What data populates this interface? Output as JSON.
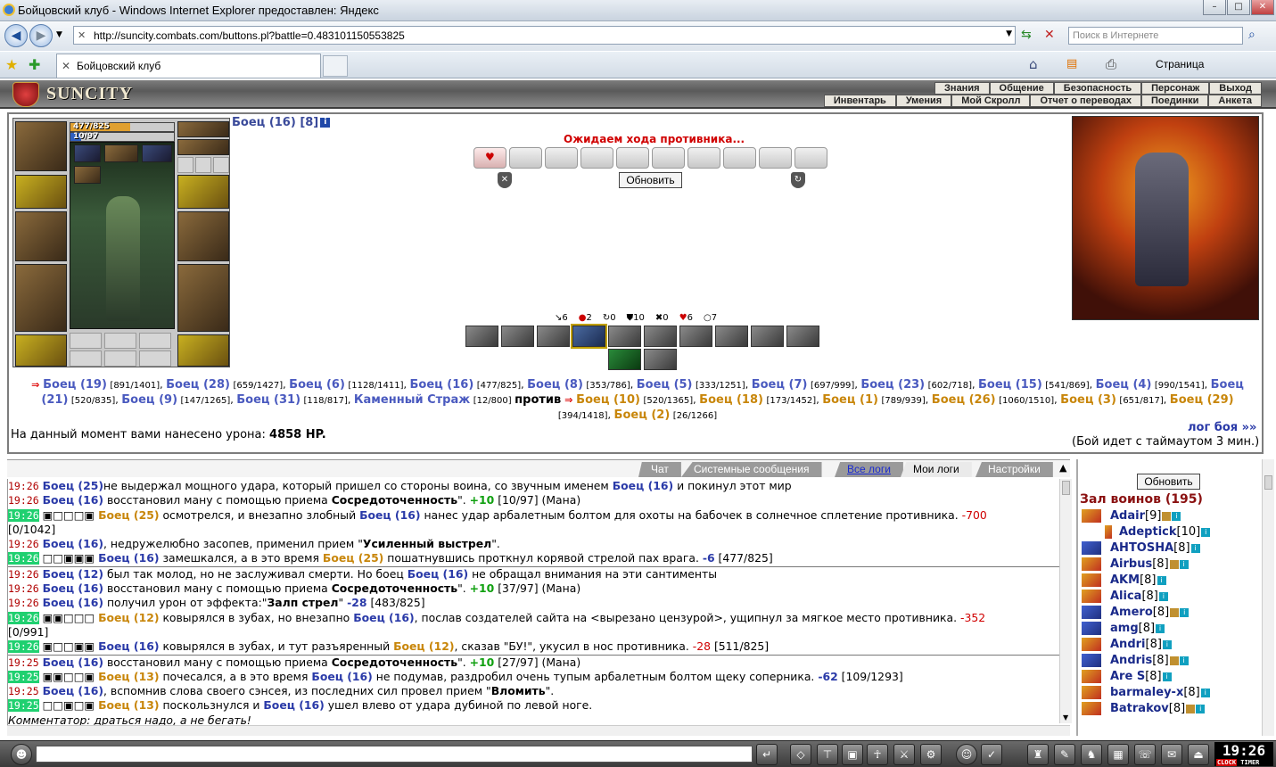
{
  "window": {
    "title": "Бойцовский клуб - Windows Internet Explorer предоставлен: Яндекс",
    "url": "http://suncity.combats.com/buttons.pl?battle=0.483101150553825",
    "search_placeholder": "Поиск в Интернете",
    "tab_title": "Бойцовский клуб",
    "page_menu": "Страница"
  },
  "header": {
    "logo": "SUNCITY",
    "menu_top": [
      "Знания",
      "Общение",
      "Безопасность",
      "Персонаж",
      "Выход"
    ],
    "menu_bottom": [
      "Инвентарь",
      "Умения",
      "Мой Скролл",
      "Отчет о переводах",
      "Поединки",
      "Анкета"
    ]
  },
  "player": {
    "name": "Боец (16) [8]",
    "hp": "477/825",
    "hp_fraction": 0.578,
    "mana": "10/97",
    "mana_fraction": 0.103
  },
  "battle": {
    "waiting": "Ожидаем хода противника...",
    "refresh": "Обновить",
    "stats": [
      "6",
      "2",
      "0",
      "10",
      "0",
      "6",
      "7"
    ],
    "damage_label": "На данный момент вами нанесено урона:",
    "damage_value": "4858 HP.",
    "log_link": "лог боя »»",
    "timeout": "(Бой идет с таймаутом 3 мин.)",
    "vs": "против",
    "team1": [
      {
        "n": "Боец (19)",
        "h": "[891/1401]"
      },
      {
        "n": "Боец (28)",
        "h": "[659/1427]"
      },
      {
        "n": "Боец (6)",
        "h": "[1128/1411]"
      },
      {
        "n": "Боец (16)",
        "h": "[477/825]"
      },
      {
        "n": "Боец (8)",
        "h": "[353/786]"
      },
      {
        "n": "Боец (5)",
        "h": "[333/1251]"
      },
      {
        "n": "Боец (7)",
        "h": "[697/999]"
      },
      {
        "n": "Боец (23)",
        "h": "[602/718]"
      },
      {
        "n": "Боец (15)",
        "h": "[541/869]"
      },
      {
        "n": "Боец (4)",
        "h": "[990/1541]"
      },
      {
        "n": "Боец (21)",
        "h": "[520/835]"
      },
      {
        "n": "Боец (9)",
        "h": "[147/1265]"
      },
      {
        "n": "Боец (31)",
        "h": "[118/817]"
      },
      {
        "n": "Каменный Страж",
        "h": "[12/800]"
      }
    ],
    "team2": [
      {
        "n": "Боец (10)",
        "h": "[520/1365]"
      },
      {
        "n": "Боец (18)",
        "h": "[173/1452]"
      },
      {
        "n": "Боец (1)",
        "h": "[789/939]"
      },
      {
        "n": "Боец (26)",
        "h": "[1060/1510]"
      },
      {
        "n": "Боец (3)",
        "h": "[651/817]"
      },
      {
        "n": "Боец (29)",
        "h": "[394/1418]"
      },
      {
        "n": "Боец (2)",
        "h": "[26/1266]"
      }
    ]
  },
  "log_tabs": [
    "Чат",
    "Системные сообщения",
    "Все логи",
    "Мои логи",
    "Настройки"
  ],
  "log": [
    {
      "t": "19:26",
      "h": false,
      "sep": false,
      "parts": [
        [
          "bl",
          "Боец (25)"
        ],
        [
          "",
          "не выдержал мощного удара, который пришел со стороны воина, со звучным именем "
        ],
        [
          "bl",
          "Боец (16)"
        ],
        [
          "",
          " и покинул этот мир"
        ]
      ]
    },
    {
      "t": "19:26",
      "h": false,
      "sep": false,
      "parts": [
        [
          "bl",
          "Боец (16)"
        ],
        [
          "",
          " восстановил ману с помощью приема "
        ],
        [
          "bb",
          "Сосредоточенность"
        ],
        [
          "",
          "\". "
        ],
        [
          "gr",
          "+10"
        ],
        [
          "",
          " [10/97] (Мана)"
        ]
      ]
    },
    {
      "t": "19:26",
      "h": true,
      "sep": false,
      "parts": [
        [
          "",
          "▣□□□▣ "
        ],
        [
          "or",
          "Боец (25)"
        ],
        [
          "",
          " осмотрелся, и внезапно злобный "
        ],
        [
          "bl",
          "Боец (16)"
        ],
        [
          "",
          " нанес удар арбалетным болтом для охоты на бабочек в солнечное сплетение противника. "
        ],
        [
          "rd",
          "-700"
        ]
      ]
    },
    {
      "t": "",
      "h": false,
      "sep": false,
      "parts": [
        [
          "",
          "[0/1042]"
        ]
      ]
    },
    {
      "t": "19:26",
      "h": false,
      "sep": false,
      "parts": [
        [
          "bl",
          "Боец (16)"
        ],
        [
          "",
          ", недружелюбно засопев, применил прием \""
        ],
        [
          "bb",
          "Усиленный выстрел"
        ],
        [
          "",
          "\"."
        ]
      ]
    },
    {
      "t": "19:26",
      "h": true,
      "sep": false,
      "parts": [
        [
          "",
          "□□▣▣▣ "
        ],
        [
          "bl",
          "Боец (16)"
        ],
        [
          "",
          " замешкался, а в это время "
        ],
        [
          "or",
          "Боец (25)"
        ],
        [
          "",
          " пошатнувшись проткнул корявой стрелой пах врага. "
        ],
        [
          "bl",
          "-6"
        ],
        [
          "",
          " [477/825]"
        ]
      ]
    },
    {
      "t": "19:26",
      "h": false,
      "sep": true,
      "parts": [
        [
          "bl",
          "Боец (12)"
        ],
        [
          "",
          " был так молод, но не заслуживал смерти. Но боец "
        ],
        [
          "bl",
          "Боец (16)"
        ],
        [
          "",
          " не обращал внимания на эти сантименты"
        ]
      ]
    },
    {
      "t": "19:26",
      "h": false,
      "sep": false,
      "parts": [
        [
          "bl",
          "Боец (16)"
        ],
        [
          "",
          " восстановил ману с помощью приема "
        ],
        [
          "bb",
          "Сосредоточенность"
        ],
        [
          "",
          "\". "
        ],
        [
          "gr",
          "+10"
        ],
        [
          "",
          " [37/97] (Мана)"
        ]
      ]
    },
    {
      "t": "19:26",
      "h": false,
      "sep": false,
      "parts": [
        [
          "bl",
          "Боец (16)"
        ],
        [
          "",
          " получил урон от эффекта:\""
        ],
        [
          "bb",
          "Залп стрел"
        ],
        [
          "",
          "\" "
        ],
        [
          "bl",
          "-28"
        ],
        [
          "",
          " [483/825]"
        ]
      ]
    },
    {
      "t": "19:26",
      "h": true,
      "sep": false,
      "parts": [
        [
          "",
          "▣▣□□□ "
        ],
        [
          "or",
          "Боец (12)"
        ],
        [
          "",
          " ковырялся в зубах, но внезапно "
        ],
        [
          "bl",
          "Боец (16)"
        ],
        [
          "",
          ", послав создателей сайта на <вырезано цензурой>, ущипнул за мягкое место противника. "
        ],
        [
          "rd",
          "-352"
        ]
      ]
    },
    {
      "t": "",
      "h": false,
      "sep": false,
      "parts": [
        [
          "",
          "[0/991]"
        ]
      ]
    },
    {
      "t": "19:26",
      "h": true,
      "sep": false,
      "parts": [
        [
          "",
          "▣□□▣▣ "
        ],
        [
          "bl",
          "Боец (16)"
        ],
        [
          "",
          " ковырялся в зубах, и тут разъяренный "
        ],
        [
          "or",
          "Боец (12)"
        ],
        [
          "",
          ", сказав \"БУ!\", укусил в нос противника. "
        ],
        [
          "rd",
          "-28"
        ],
        [
          "",
          " [511/825]"
        ]
      ]
    },
    {
      "t": "19:25",
      "h": false,
      "sep": true,
      "parts": [
        [
          "bl",
          "Боец (16)"
        ],
        [
          "",
          " восстановил ману с помощью приема "
        ],
        [
          "bb",
          "Сосредоточенность"
        ],
        [
          "",
          "\". "
        ],
        [
          "gr",
          "+10"
        ],
        [
          "",
          " [27/97] (Мана)"
        ]
      ]
    },
    {
      "t": "19:25",
      "h": true,
      "sep": false,
      "parts": [
        [
          "",
          "▣▣□□▣ "
        ],
        [
          "or",
          "Боец (13)"
        ],
        [
          "",
          " почесался, а в это время "
        ],
        [
          "bl",
          "Боец (16)"
        ],
        [
          "",
          " не подумав, раздробил очень тупым арбалетным болтом щеку соперника. "
        ],
        [
          "bl",
          "-62"
        ],
        [
          "",
          " [109/1293]"
        ]
      ]
    },
    {
      "t": "19:25",
      "h": false,
      "sep": false,
      "parts": [
        [
          "bl",
          "Боец (16)"
        ],
        [
          "",
          ", вспомнив слова своего сэнсея, из последних сил провел прием \""
        ],
        [
          "bb",
          "Вломить"
        ],
        [
          "",
          "\"."
        ]
      ]
    },
    {
      "t": "19:25",
      "h": true,
      "sep": false,
      "parts": [
        [
          "",
          "□□▣□▣ "
        ],
        [
          "or",
          "Боец (13)"
        ],
        [
          "",
          " поскользнулся и "
        ],
        [
          "bl",
          "Боец (16)"
        ],
        [
          "",
          " ушел влево от удара дубиной по левой ноге."
        ]
      ]
    },
    {
      "t": "",
      "h": false,
      "sep": false,
      "parts": [
        [
          "it",
          "Комментатор: драться надо, а не бегать!"
        ]
      ]
    }
  ],
  "room": {
    "refresh": "Обновить",
    "title": "Зал воинов (195)",
    "players": [
      {
        "n": "Adair",
        "l": "[9]",
        "c": "o"
      },
      {
        "n": "Adeptick",
        "l": "[10]",
        "c": "o",
        "indent": true
      },
      {
        "n": "AHTOSHA",
        "l": "[8]",
        "c": "b"
      },
      {
        "n": "Airbus",
        "l": "[8]",
        "c": "o"
      },
      {
        "n": "AKM",
        "l": "[8]",
        "c": "o"
      },
      {
        "n": "Alica",
        "l": "[8]",
        "c": "o"
      },
      {
        "n": "Amero",
        "l": "[8]",
        "c": "b"
      },
      {
        "n": "amg",
        "l": "[8]",
        "c": "b"
      },
      {
        "n": "Andri",
        "l": "[8]",
        "c": "o"
      },
      {
        "n": "Andris",
        "l": "[8]",
        "c": "b"
      },
      {
        "n": "Are S",
        "l": "[8]",
        "c": "o"
      },
      {
        "n": "barmaley-x",
        "l": "[8]",
        "c": "o"
      },
      {
        "n": "Batrakov",
        "l": "[8]",
        "c": "o"
      }
    ]
  },
  "clock": {
    "time": "19:26",
    "label_clock": "CLOCK",
    "label_timer": "TIMER"
  }
}
